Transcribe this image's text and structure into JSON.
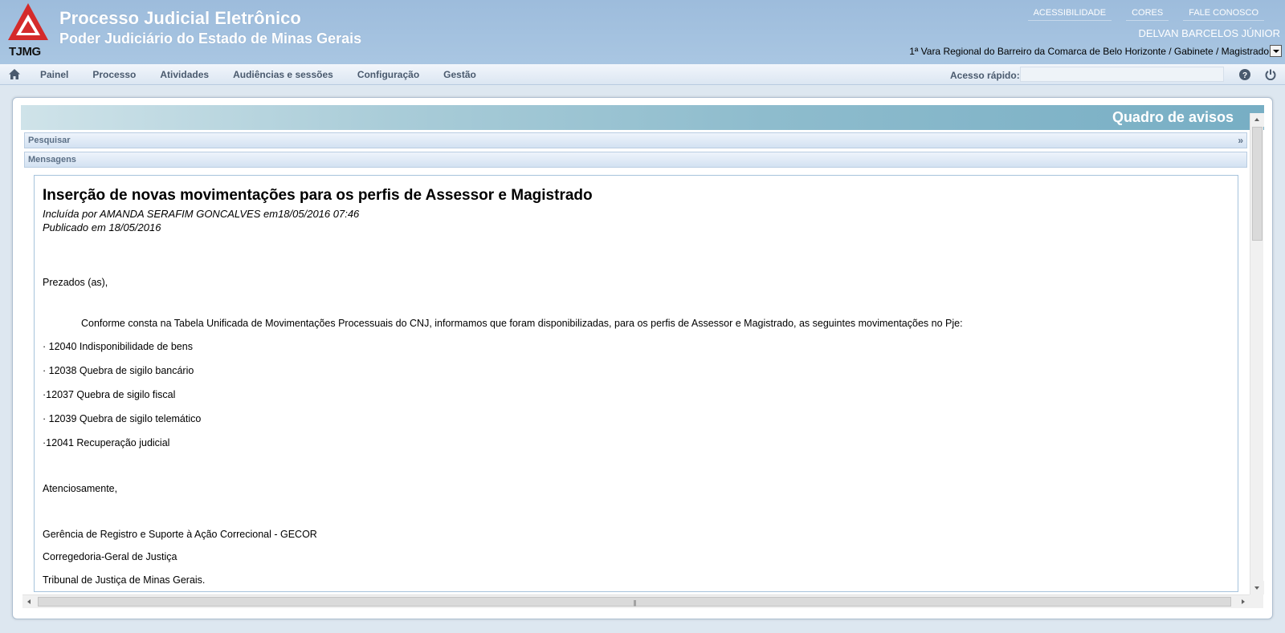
{
  "header": {
    "logo_text": "TJMG",
    "title": "Processo Judicial Eletrônico",
    "subtitle": "Poder Judiciário do Estado de Minas Gerais",
    "links": [
      "ACESSIBILIDADE",
      "CORES",
      "FALE CONOSCO"
    ],
    "user_name": "DELVAN BARCELOS JÚNIOR",
    "location": "1ª Vara Regional do Barreiro da Comarca de Belo Horizonte / Gabinete / Magistrado",
    "logo_color": "#d42a2a"
  },
  "menu": {
    "items": [
      "Painel",
      "Processo",
      "Atividades",
      "Audiências e sessões",
      "Configuração",
      "Gestão"
    ],
    "quick_access_label": "Acesso rápido:",
    "quick_access_value": ""
  },
  "panel": {
    "title": "Quadro de avisos",
    "search_label": "Pesquisar",
    "search_expand": "»",
    "messages_label": "Mensagens"
  },
  "message": {
    "title": "Inserção de novas movimentações para os perfis de Assessor e Magistrado",
    "included_by": "Incluída por AMANDA SERAFIM GONCALVES em18/05/2016 07:46",
    "published": "Publicado em 18/05/2016",
    "greeting": "Prezados (as),",
    "intro": "Conforme consta na Tabela Unificada de Movimentações Processuais do CNJ, informamos que foram disponibilizadas, para os perfis de Assessor e Magistrado, as seguintes movimentações no Pje:",
    "items": [
      "· 12040 Indisponibilidade de bens",
      "· 12038 Quebra de sigilo bancário",
      "·12037 Quebra de sigilo fiscal",
      "· 12039 Quebra de sigilo telemático",
      "·12041 Recuperação judicial"
    ],
    "closing": "Atenciosamente,",
    "signature": [
      "Gerência de Registro e Suporte à Ação Correcional - GECOR",
      "Corregedoria-Geral de Justiça",
      "Tribunal de Justiça de Minas Gerais."
    ]
  }
}
